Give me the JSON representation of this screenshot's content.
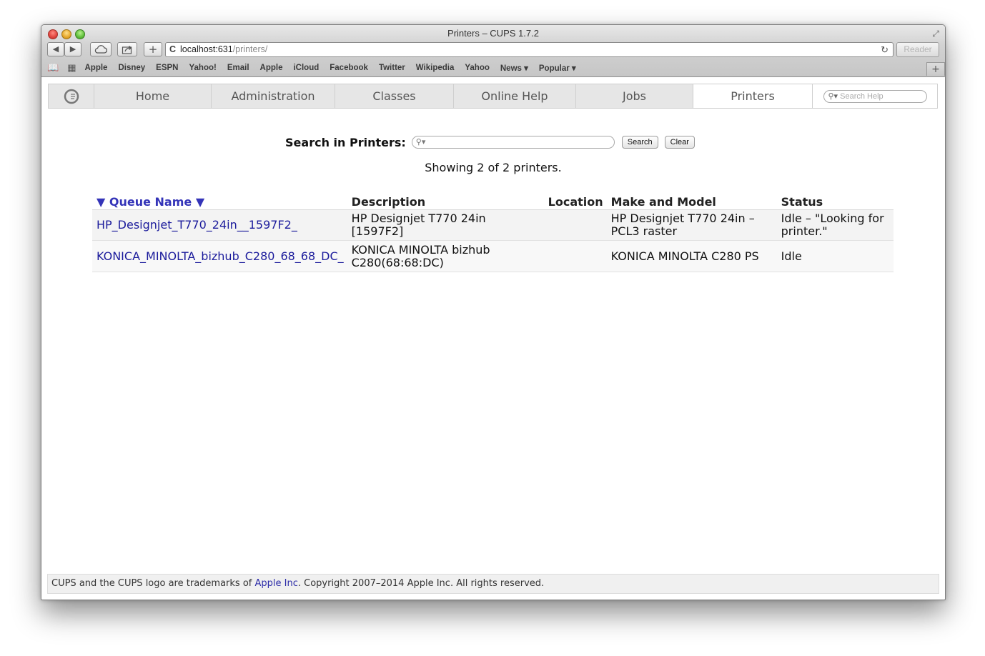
{
  "window": {
    "title": "Printers – CUPS 1.7.2",
    "url_host": "localhost:631",
    "url_path": "/printers/",
    "reader_label": "Reader"
  },
  "bookmarks": [
    "Apple",
    "Disney",
    "ESPN",
    "Yahoo!",
    "Email",
    "Apple",
    "iCloud",
    "Facebook",
    "Twitter",
    "Wikipedia",
    "Yahoo",
    "News ▾",
    "Popular ▾"
  ],
  "nav": {
    "tabs": [
      "Home",
      "Administration",
      "Classes",
      "Online Help",
      "Jobs",
      "Printers"
    ],
    "active": "Printers",
    "help_search_placeholder": "Search Help"
  },
  "search": {
    "label": "Search in Printers:",
    "search_button": "Search",
    "clear_button": "Clear"
  },
  "showing": "Showing 2 of 2 printers.",
  "table": {
    "headers": [
      "▼ Queue Name ▼",
      "Description",
      "Location",
      "Make and Model",
      "Status"
    ],
    "rows": [
      {
        "queue": "HP_Designjet_T770_24in__1597F2_",
        "description": "HP Designjet T770 24in [1597F2]",
        "location": "",
        "model": "HP Designjet T770 24in – PCL3 raster",
        "status": "Idle – \"Looking for printer.\""
      },
      {
        "queue": "KONICA_MINOLTA_bizhub_C280_68_68_DC_",
        "description": "KONICA MINOLTA bizhub C280(68:68:DC)",
        "location": "",
        "model": "KONICA MINOLTA C280 PS",
        "status": "Idle"
      }
    ]
  },
  "footer": {
    "before": "CUPS and the CUPS logo are trademarks of ",
    "link": "Apple Inc",
    "after": ". Copyright 2007–2014 Apple Inc. All rights reserved."
  }
}
